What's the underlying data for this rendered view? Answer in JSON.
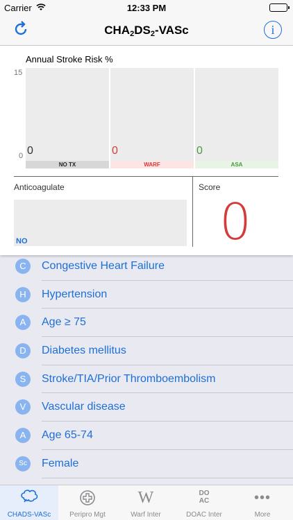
{
  "status_bar": {
    "carrier": "Carrier",
    "time": "12:33 PM"
  },
  "nav": {
    "title_main": "CHA",
    "title_sub1": "2",
    "title_mid": "DS",
    "title_sub2": "2",
    "title_end": "-VASc",
    "info_glyph": "i"
  },
  "colors": {
    "accent": "#1d6fd8",
    "score": "#d43b3b",
    "warf_band": "#fde5e6",
    "asa_band": "#e8f4e6"
  },
  "chart_data": {
    "type": "bar",
    "title": "Annual Stroke Risk %",
    "categories": [
      "NO TX",
      "WARF",
      "ASA"
    ],
    "values": [
      0,
      0,
      0
    ],
    "ylim": [
      0,
      15
    ],
    "y_ticks": [
      "15",
      "0"
    ],
    "value_labels": [
      "0",
      "0",
      "0"
    ],
    "value_colors": [
      "#333333",
      "#d43b3b",
      "#4a9a3c"
    ]
  },
  "anticoagulate": {
    "label": "Anticoagulate",
    "value": "NO"
  },
  "score": {
    "label": "Score",
    "value": "0"
  },
  "criteria": [
    {
      "letter": "C",
      "label": "Congestive Heart Failure"
    },
    {
      "letter": "H",
      "label": "Hypertension"
    },
    {
      "letter": "A",
      "label": "Age ≥ 75"
    },
    {
      "letter": "D",
      "label": "Diabetes mellitus"
    },
    {
      "letter": "S",
      "label": "Stroke/TIA/Prior Thromboembolism"
    },
    {
      "letter": "V",
      "label": "Vascular disease"
    },
    {
      "letter": "A",
      "label": "Age 65-74"
    },
    {
      "letter": "Sc",
      "label": "Female"
    }
  ],
  "tabs": [
    {
      "label": "CHADS-VASc",
      "icon": "brain-icon",
      "active": true
    },
    {
      "label": "Peripro Mgt",
      "icon": "medical-cross-icon",
      "active": false
    },
    {
      "label": "Warf Inter",
      "icon": "w-icon",
      "active": false
    },
    {
      "label": "DOAC Inter",
      "icon": "doac-icon",
      "active": false
    },
    {
      "label": "More",
      "icon": "more-icon",
      "active": false
    }
  ]
}
